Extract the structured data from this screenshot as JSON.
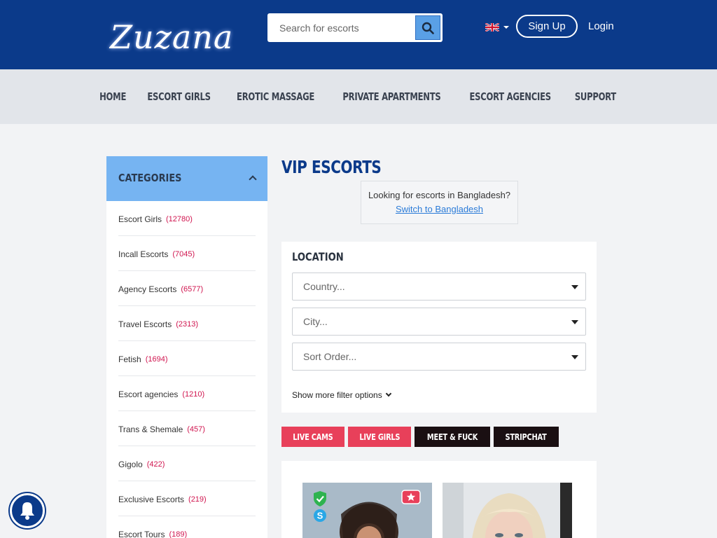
{
  "header": {
    "logo_text": "Zuzana",
    "search_placeholder": "Search for escorts",
    "signup_label": "Sign Up",
    "login_label": "Login",
    "language_flag": "uk-flag-icon"
  },
  "nav": {
    "items": [
      "HOME",
      "ESCORT GIRLS",
      "EROTIC MASSAGE",
      "PRIVATE APARTMENTS",
      "ESCORT AGENCIES",
      "SUPPORT"
    ]
  },
  "sidebar": {
    "title": "CATEGORIES",
    "items": [
      {
        "label": "Escort Girls",
        "count": "(12780)"
      },
      {
        "label": "Incall Escorts",
        "count": "(7045)"
      },
      {
        "label": "Agency Escorts",
        "count": "(6577)"
      },
      {
        "label": "Travel Escorts",
        "count": "(2313)"
      },
      {
        "label": "Fetish",
        "count": "(1694)"
      },
      {
        "label": "Escort agencies",
        "count": "(1210)"
      },
      {
        "label": "Trans & Shemale",
        "count": "(457)"
      },
      {
        "label": "Gigolo",
        "count": "(422)"
      },
      {
        "label": "Exclusive Escorts",
        "count": "(219)"
      },
      {
        "label": "Escort Tours",
        "count": "(189)"
      }
    ]
  },
  "main": {
    "title": "VIP ESCORTS",
    "notice_text": "Looking for escorts in Bangladesh?",
    "notice_link": "Switch to Bangladesh",
    "filter": {
      "title": "LOCATION",
      "country_placeholder": "Country...",
      "city_placeholder": "City...",
      "sort_placeholder": "Sort Order...",
      "more_label": "Show more filter options"
    },
    "tags": [
      {
        "label": "LIVE CAMS",
        "style": "red"
      },
      {
        "label": "LIVE GIRLS",
        "style": "red"
      },
      {
        "label": "MEET & FUCK",
        "style": "dark"
      },
      {
        "label": "STRIPCHAT",
        "style": "dark"
      }
    ]
  },
  "colors": {
    "header_bg": "#0b3a8a",
    "nav_bg": "#e2e5ea",
    "category_header_bg": "#76b4f2",
    "count_color": "#d0154f",
    "tag_red": "#e8405a",
    "tag_dark": "#1a0f12"
  }
}
